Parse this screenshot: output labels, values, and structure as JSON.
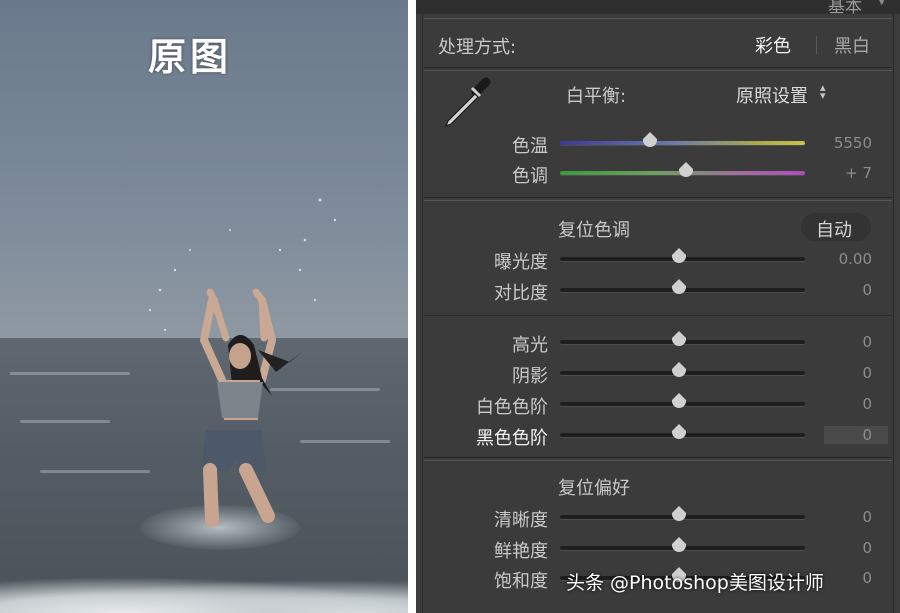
{
  "photo": {
    "caption": "原图"
  },
  "panel": {
    "header_partial": "基本",
    "treatment": {
      "label": "处理方式:",
      "color_option": "彩色",
      "bw_option": "黑白"
    },
    "white_balance": {
      "label": "白平衡:",
      "preset": "原照设置",
      "preset_arrow": "⌃⌄",
      "temp": {
        "label": "色温",
        "value": "5550",
        "fraction": 0.38
      },
      "tint": {
        "label": "色调",
        "value": "+ 7",
        "fraction": 0.53
      }
    },
    "tone": {
      "reset_label": "复位色调",
      "auto_label": "自动",
      "sliders": [
        {
          "label": "曝光度",
          "value": "0.00",
          "fraction": 0.5
        },
        {
          "label": "对比度",
          "value": "0",
          "fraction": 0.5
        },
        {
          "label": "高光",
          "value": "0",
          "fraction": 0.5
        },
        {
          "label": "阴影",
          "value": "0",
          "fraction": 0.5
        },
        {
          "label": "白色色阶",
          "value": "0",
          "fraction": 0.5
        },
        {
          "label": "黑色色阶",
          "value": "0",
          "fraction": 0.5
        }
      ]
    },
    "presence": {
      "reset_label": "复位偏好",
      "sliders": [
        {
          "label": "清晰度",
          "value": "0",
          "fraction": 0.5
        },
        {
          "label": "鲜艳度",
          "value": "0",
          "fraction": 0.5
        },
        {
          "label": "饱和度",
          "value": "0",
          "fraction": 0.5
        }
      ]
    }
  },
  "watermark": "头条 @Photoshop美图设计师",
  "colors": {
    "panel_bg": "#3c3c3c",
    "text": "#c6c6c6",
    "thumb": "#d0d0d0"
  }
}
